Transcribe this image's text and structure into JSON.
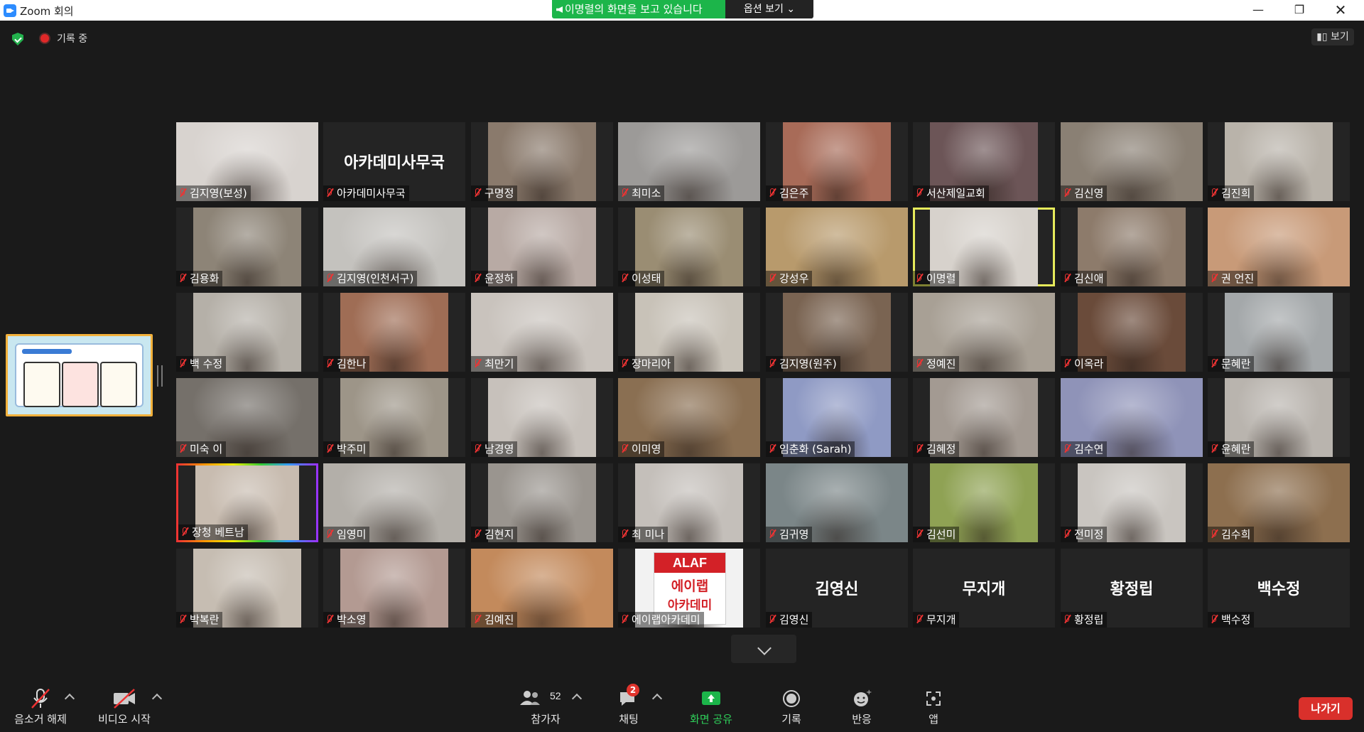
{
  "window": {
    "title": "Zoom 회의"
  },
  "share_banner": {
    "text": "이명렬의 화면을 보고 있습니다",
    "options_label": "옵션 보기"
  },
  "meeting_bar": {
    "recording_label": "기록 중",
    "view_label": "보기"
  },
  "participants": [
    {
      "name": "김지영(보성)",
      "video": true,
      "bg": "#d8d3cf"
    },
    {
      "name": "아카데미사무국",
      "video": false,
      "display_name": "아카데미사무국"
    },
    {
      "name": "구명정",
      "video": true,
      "bg": "#8a7a6c"
    },
    {
      "name": "최미소",
      "video": true,
      "bg": "#9c9a98"
    },
    {
      "name": "김은주",
      "video": true,
      "bg": "#a86b58"
    },
    {
      "name": "서산제일교회",
      "video": true,
      "bg": "#6c5557"
    },
    {
      "name": "김신영",
      "video": true,
      "bg": "#8a8074"
    },
    {
      "name": "김진희",
      "video": true,
      "bg": "#b9b3aa"
    },
    {
      "name": "김용화",
      "video": true,
      "bg": "#8d8477"
    },
    {
      "name": "김지영(인천서구)",
      "video": true,
      "bg": "#c4c2be"
    },
    {
      "name": "윤정하",
      "video": true,
      "bg": "#b8aaa4"
    },
    {
      "name": "이성태",
      "video": true,
      "bg": "#9a8d73"
    },
    {
      "name": "강성우",
      "video": true,
      "bg": "#b89a6c"
    },
    {
      "name": "이명렬",
      "video": true,
      "bg": "#d7d2cc",
      "active": true
    },
    {
      "name": "김신애",
      "video": true,
      "bg": "#8d7b6b"
    },
    {
      "name": "권 언진",
      "video": true,
      "bg": "#c89a78"
    },
    {
      "name": "백 수정",
      "video": true,
      "bg": "#b5b0a8"
    },
    {
      "name": "김한나",
      "video": true,
      "bg": "#9f6d55"
    },
    {
      "name": "최만기",
      "video": true,
      "bg": "#c9c3bd"
    },
    {
      "name": "장마리아",
      "video": true,
      "bg": "#c8c2b8"
    },
    {
      "name": "김지영(원주)",
      "video": true,
      "bg": "#7a6452"
    },
    {
      "name": "정예진",
      "video": true,
      "bg": "#a8a095"
    },
    {
      "name": "이옥라",
      "video": true,
      "bg": "#6a4b3a"
    },
    {
      "name": "문혜란",
      "video": true,
      "bg": "#a4a8aa"
    },
    {
      "name": "미숙 이",
      "video": true,
      "bg": "#75706a"
    },
    {
      "name": "박주미",
      "video": true,
      "bg": "#9d9588"
    },
    {
      "name": "남경영",
      "video": true,
      "bg": "#c7c1bb"
    },
    {
      "name": "이미영",
      "video": true,
      "bg": "#8a6f52"
    },
    {
      "name": "임춘화 (Sarah)",
      "video": true,
      "bg": "#8f9ac4"
    },
    {
      "name": "김혜정",
      "video": true,
      "bg": "#a39a92"
    },
    {
      "name": "김수연",
      "video": true,
      "bg": "#8f93b8"
    },
    {
      "name": "윤혜란",
      "video": true,
      "bg": "#b9b4ae"
    },
    {
      "name": "장청 베트남",
      "video": true,
      "bg": "#c8bcb0",
      "rainbow": true
    },
    {
      "name": "임영미",
      "video": true,
      "bg": "#b3afa9"
    },
    {
      "name": "김현지",
      "video": true,
      "bg": "#9a958f"
    },
    {
      "name": "최 미나",
      "video": true,
      "bg": "#c4bfba"
    },
    {
      "name": "김귀영",
      "video": true,
      "bg": "#7b8688"
    },
    {
      "name": "김선미",
      "video": true,
      "bg": "#8fa254"
    },
    {
      "name": "전미정",
      "video": true,
      "bg": "#c9c5c0"
    },
    {
      "name": "김수희",
      "video": true,
      "bg": "#8d6f4f"
    },
    {
      "name": "박복란",
      "video": true,
      "bg": "#c6bdb2"
    },
    {
      "name": "박소영",
      "video": true,
      "bg": "#b39a92"
    },
    {
      "name": "김예진",
      "video": true,
      "bg": "#c38a5c"
    },
    {
      "name": "에이랩아카데미",
      "video": true,
      "bg": "#f2f2f2",
      "logo": {
        "line1": "ALAF",
        "line2": "에이랩",
        "line3": "아카데미"
      }
    },
    {
      "name": "김영신",
      "video": false,
      "display_name": "김영신"
    },
    {
      "name": "무지개",
      "video": false,
      "display_name": "무지개"
    },
    {
      "name": "황정립",
      "video": false,
      "display_name": "황정립"
    },
    {
      "name": "백수정",
      "video": false,
      "display_name": "백수정"
    }
  ],
  "toolbar": {
    "unmute_label": "음소거 해제",
    "video_label": "비디오 시작",
    "participants_label": "참가자",
    "participants_count": "52",
    "chat_label": "채팅",
    "chat_badge": "2",
    "share_label": "화면 공유",
    "record_label": "기록",
    "reactions_label": "반응",
    "apps_label": "앱",
    "leave_label": "나가기"
  },
  "colors": {
    "share_green": "#1cb54a",
    "leave_red": "#d9302b",
    "active_speaker": "#e6ea5b"
  }
}
